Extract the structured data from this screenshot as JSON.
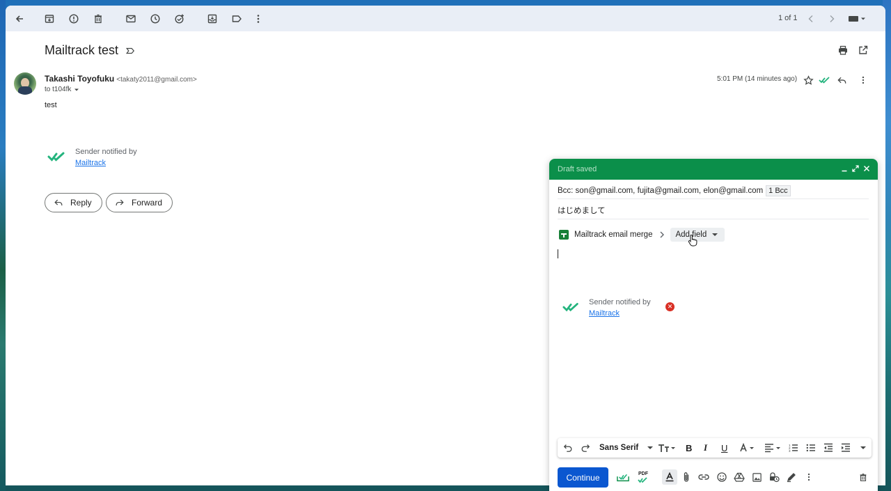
{
  "toolbar": {
    "icons": [
      "back-arrow-icon",
      "archive-icon",
      "report-spam-icon",
      "delete-icon",
      "mark-unread-icon",
      "snooze-icon",
      "add-task-icon",
      "move-to-icon",
      "label-icon",
      "more-vert-icon"
    ],
    "pager": "1 of 1"
  },
  "email": {
    "subject": "Mailtrack test",
    "sender_name": "Takashi Toyofuku",
    "sender_email": "<takaty2011@gmail.com>",
    "to": "to t104fk",
    "body": "test",
    "timestamp": "5:01 PM (14 minutes ago)",
    "notify_text": "Sender notified by",
    "notify_link": "Mailtrack",
    "reply_label": "Reply",
    "forward_label": "Forward"
  },
  "compose": {
    "title": "Draft saved",
    "bcc": "Bcc: son@gmail.com, fujita@gmail.com, elon@gmail.com",
    "bcc_chip": "1 Bcc",
    "subject": "はじめまして",
    "merge_label": "Mailtrack email merge",
    "add_field_label": "Add field",
    "notify_text": "Sender notified by",
    "notify_link": "Mailtrack",
    "font_name": "Sans Serif",
    "continue_label": "Continue",
    "pdf_label": "PDF"
  },
  "colors": {
    "compose_header": "#0b8f4a",
    "mailtrack_check": "#24b47e",
    "primary_button": "#0b57d0",
    "toolbar_bg": "#e9eef6"
  }
}
